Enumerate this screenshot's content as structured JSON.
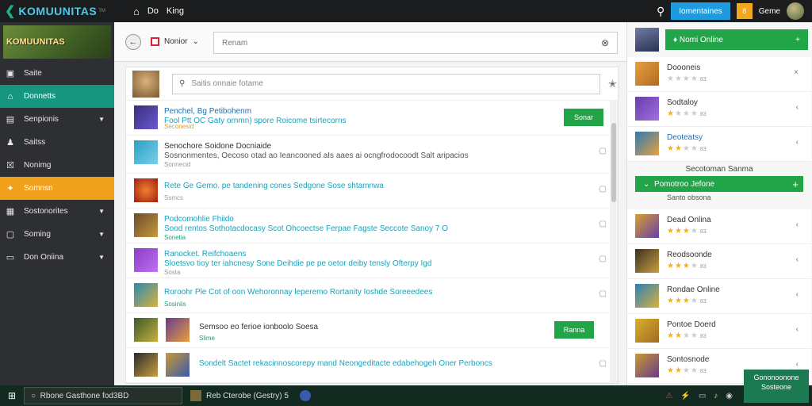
{
  "topbar": {
    "brand": "KOMUUNITAS",
    "brand_sup": "TM",
    "nav": [
      "Do",
      "King"
    ],
    "cta_label": "Iomentaines",
    "badge": "8",
    "user_label": "Geme"
  },
  "sidebar": {
    "logo_text": "KOMUUNITAS",
    "items": [
      {
        "label": "Saite",
        "icon": "home-icon",
        "chev": false
      },
      {
        "label": "Donnetts",
        "icon": "community-icon",
        "chev": false
      },
      {
        "label": "Senpionis",
        "icon": "games-icon",
        "chev": true
      },
      {
        "label": "Saitss",
        "icon": "user-icon",
        "chev": false
      },
      {
        "label": "Nonimg",
        "icon": "news-icon",
        "chev": false
      },
      {
        "label": "Somnsn",
        "icon": "trophy-icon",
        "chev": false
      },
      {
        "label": "Sostonorites",
        "icon": "chart-icon",
        "chev": true
      },
      {
        "label": "Soming",
        "icon": "settings-icon",
        "chev": true
      },
      {
        "label": "Don Oniina",
        "icon": "monitor-icon",
        "chev": true
      }
    ]
  },
  "main": {
    "filter_label": "Nonior",
    "search_placeholder": "Renam",
    "list_search_placeholder": "Saitis onnaie fotame",
    "rows": [
      {
        "title": "Penchel, Bg Petibohenm",
        "desc": "Fool Ptt OC Gaty ornmn) spore Roicome tsirtecorns",
        "meta": "Seconesid",
        "action": "Sonar",
        "thumb": "#3a2e7a"
      },
      {
        "title": "Senochore Soidone Docniaide",
        "desc": "Sosnonmentes, Oecoso otad ao Ieancooned aIs aaes ai ocngfrodocoodt Salt aripacios",
        "meta": "Sonnecid",
        "action": "",
        "thumb": "#2a9fc4"
      },
      {
        "title": "",
        "desc": "Rete Ge Gemo. pe tandening cones Sedgone Sose shtamnwa",
        "meta": "Ssmcs",
        "action": "",
        "thumb": "#d04a1e"
      },
      {
        "title": "Podcomohlie Fhiido",
        "desc": "Sood rentos Sothotacdocasy Scot Ohcoectse Ferpae Fagste Seccote Sanoy 7 O",
        "meta": "Sonetia",
        "action": "",
        "thumb": "#6b4a2a"
      },
      {
        "title": "Ranocket. Reifchoaens",
        "desc": "Sloetsvo tioy ter iahcnesy Sone Deihdie pe pe oetor deiby tensly Ofterpy Igd",
        "meta": "Sosta",
        "action": "",
        "thumb": "#8a3cc8"
      },
      {
        "title": "",
        "desc": "Roroohr Ple Cot of oon Wehoronnay leperemo Rortanity Ioshde Soreeedees",
        "meta": "Sosiniis",
        "action": "",
        "thumb": "#2a8ab0"
      },
      {
        "title": "",
        "desc": "Semsoo eo ferioe ionboolo Soesa",
        "meta": "Slime",
        "action": "Ranna",
        "thumb": "#3a5a2a"
      },
      {
        "title": "",
        "desc": "Sondelt Sactet rekacinnoscorepy mand Neongeditacte edabehogeh Oner Perboncs",
        "meta": "",
        "action": "",
        "thumb": "#2a2a2a"
      }
    ]
  },
  "right": {
    "online_label": "Nomi Online",
    "friends": [
      {
        "name": "Doooneis",
        "stars": 0,
        "score": "83",
        "icon": "×",
        "color": "#e8a040"
      },
      {
        "name": "Sodtaloy",
        "stars": 1,
        "score": "83",
        "icon": "‹",
        "color": "#6a3ca8"
      },
      {
        "name": "Deoteatsy",
        "stars": 2,
        "score": "83",
        "icon": "‹",
        "color": "#2a7ab8"
      },
      {
        "name": "Dead Onlina",
        "stars": 3,
        "score": "83",
        "icon": "‹",
        "color": "#d8a030"
      },
      {
        "name": "Reodsoonde",
        "stars": 3,
        "score": "83",
        "icon": "‹",
        "color": "#3a3020"
      },
      {
        "name": "Rondae Online",
        "stars": 3,
        "score": "83",
        "icon": "‹",
        "color": "#2a80b8"
      },
      {
        "name": "Pontoe Doerd",
        "stars": 2,
        "score": "83",
        "icon": "‹",
        "color": "#d8b030"
      },
      {
        "name": "Sontosnode",
        "stars": 2,
        "score": "83",
        "icon": "‹",
        "color": "#c89a30"
      }
    ],
    "section_label": "Secotoman Sanma",
    "section_btn": "Pomotroo Jefone",
    "section_sub": "Santo obsona"
  },
  "taskbar": {
    "search_text": "Rbone Gasthone fod3BD",
    "app_label": "Reb Cterobe (Gestry) 5",
    "toast": "Gononoonone Sosteone"
  }
}
